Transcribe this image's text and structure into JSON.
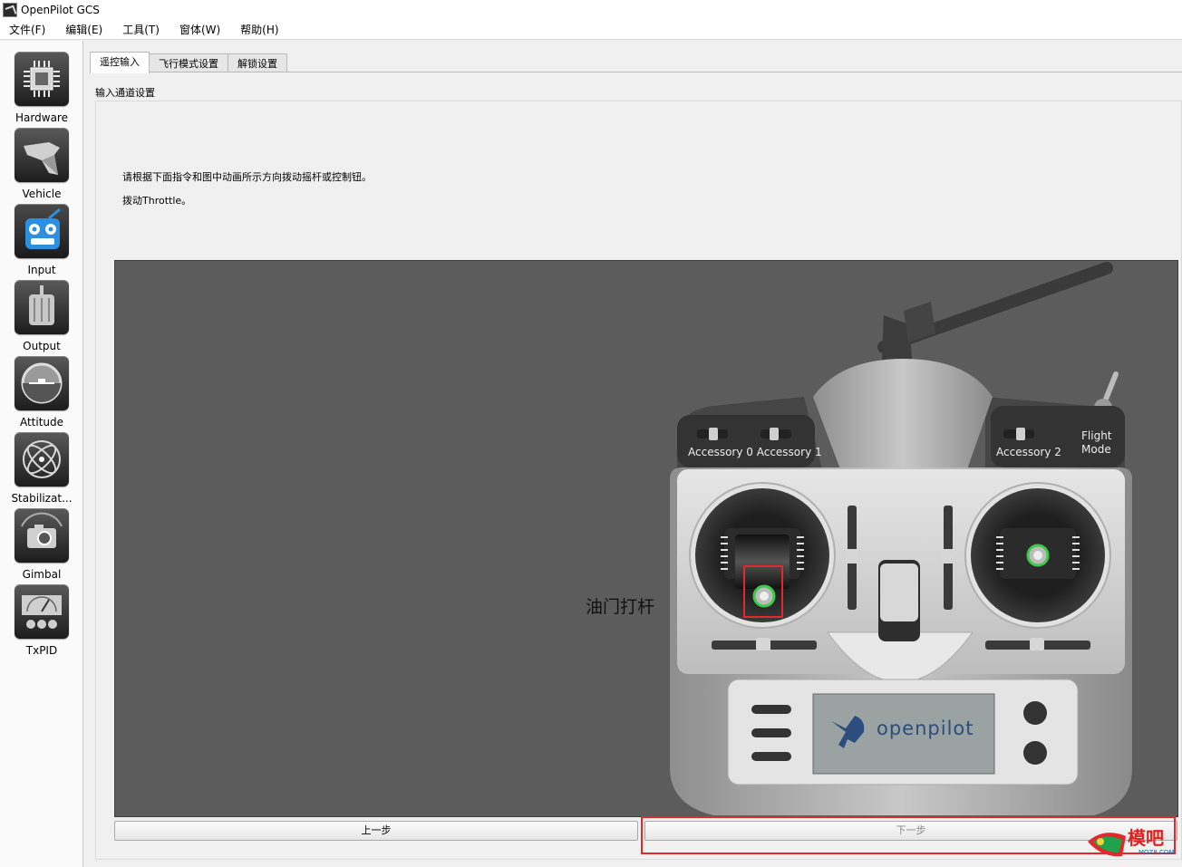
{
  "window": {
    "title": "OpenPilot GCS"
  },
  "menu": [
    "文件(F)",
    "编辑(E)",
    "工具(T)",
    "窗体(W)",
    "帮助(H)"
  ],
  "sidebar": [
    {
      "label": "Hardware",
      "icon": "chip-icon"
    },
    {
      "label": "Vehicle",
      "icon": "aircraft-icon"
    },
    {
      "label": "Input",
      "icon": "transmitter-icon",
      "active": true
    },
    {
      "label": "Output",
      "icon": "motor-icon"
    },
    {
      "label": "Attitude",
      "icon": "attitude-indicator-icon"
    },
    {
      "label": "Stabilizat...",
      "icon": "gyro-icon"
    },
    {
      "label": "Gimbal",
      "icon": "camera-icon"
    },
    {
      "label": "TxPID",
      "icon": "gauge-icon"
    }
  ],
  "tabs": [
    "遥控输入",
    "飞行模式设置",
    "解锁设置"
  ],
  "panel": {
    "group_title": "输入通道设置",
    "instruction_line1": "请根据下面指令和图中动画所示方向拨动摇杆或控制钮。",
    "instruction_line2": "拨动Throttle。"
  },
  "annotation": {
    "label": "油门打杆"
  },
  "transmitter": {
    "switch_left_label": "Accessory 0 Accessory 1",
    "switch_right_label": "Accessory 2",
    "flight_mode_line1": "Flight",
    "flight_mode_line2": "Mode",
    "brand": "openpilot"
  },
  "buttons": {
    "prev": "上一步",
    "next": "下一步"
  },
  "watermark": {
    "text": "模吧",
    "url": "MOZ8.COM"
  },
  "colors": {
    "highlight": "#e0282e",
    "stick_ring": "#3ec94a",
    "stage_bg": "#5c5c5c"
  }
}
